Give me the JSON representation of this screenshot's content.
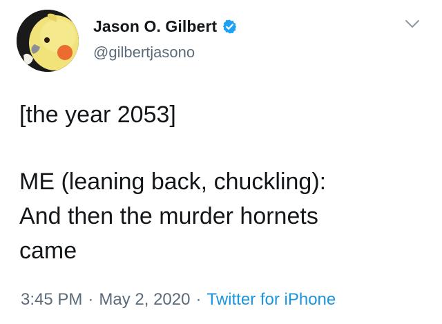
{
  "user": {
    "display_name": "Jason O. Gilbert",
    "handle": "@gilbertjasono",
    "verified": true
  },
  "tweet": {
    "lines": [
      "[the year 2053]",
      "ME (leaning back, chuckling):",
      "And then the murder hornets",
      "came"
    ],
    "time": "3:45 PM",
    "date": "May 2, 2020",
    "source": "Twitter for iPhone",
    "separator": "·"
  },
  "icons": {
    "verified": "verified-badge-icon",
    "menu": "chevron-down-icon"
  },
  "colors": {
    "text": "#14171a",
    "muted": "#5b6b79",
    "link": "#1b95e0",
    "verified": "#1da1f2"
  }
}
